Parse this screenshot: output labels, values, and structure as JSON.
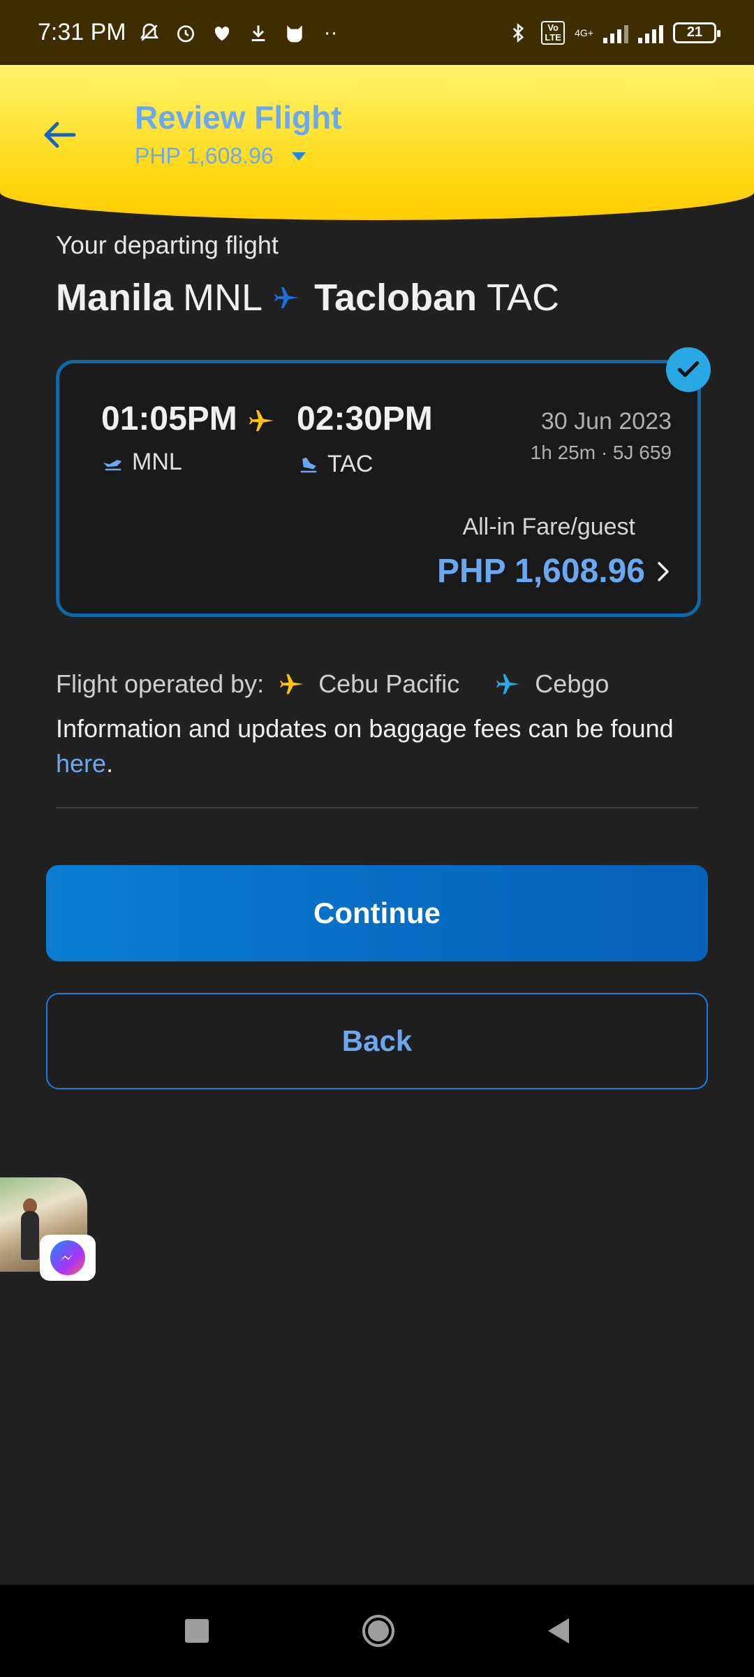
{
  "status_bar": {
    "time": "7:31 PM",
    "battery": "21",
    "network": "4G+",
    "volte": "Vo LTE"
  },
  "header": {
    "title": "Review Flight",
    "price": "PHP 1,608.96"
  },
  "route": {
    "label": "Your departing flight",
    "origin_city": "Manila",
    "origin_code": "MNL",
    "dest_city": "Tacloban",
    "dest_code": "TAC"
  },
  "flight": {
    "depart_time": "01:05PM",
    "arrive_time": "02:30PM",
    "depart_code": "MNL",
    "arrive_code": "TAC",
    "date": "30 Jun 2023",
    "duration_flight": "1h 25m · 5J 659",
    "fare_label": "All-in Fare/guest",
    "fare_value": "PHP 1,608.96"
  },
  "operators": {
    "label": "Flight operated by:",
    "airlines": [
      "Cebu Pacific",
      "Cebgo"
    ]
  },
  "baggage": {
    "text": "Information and updates on baggage fees can be found ",
    "link": "here",
    "suffix": "."
  },
  "buttons": {
    "continue": "Continue",
    "back": "Back"
  },
  "colors": {
    "header_yellow": "#ffd815",
    "accent_blue": "#6aa8f2",
    "button_blue": "#0a7cd1",
    "cebu_pacific": "#ffc20e",
    "cebgo": "#29a9e3"
  }
}
